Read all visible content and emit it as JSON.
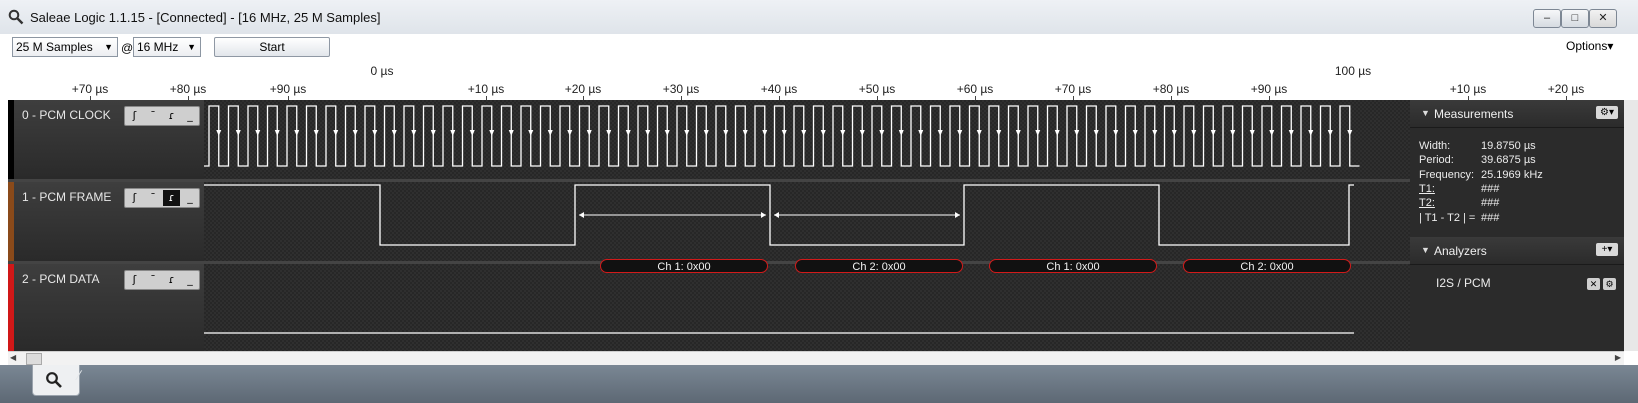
{
  "window": {
    "title": "Saleae Logic 1.1.15 - [Connected] - [16 MHz, 25 M Samples]",
    "controls": {
      "minimize": "–",
      "maximize": "□",
      "close": "✕"
    }
  },
  "toolbar": {
    "samples": "25 M Samples",
    "at": "@",
    "rate": "16 MHz",
    "start": "Start",
    "options": "Options▾"
  },
  "ruler": {
    "major_labels": [
      "0 µs",
      "100 µs"
    ],
    "minor_labels": [
      "+70 µs",
      "+80 µs",
      "+90 µs",
      "+10 µs",
      "+20 µs",
      "+30 µs",
      "+40 µs",
      "+50 µs",
      "+60 µs",
      "+70 µs",
      "+80 µs",
      "+90 µs",
      "+10 µs",
      "+20 µs"
    ]
  },
  "channels": [
    {
      "name": "0 - PCM CLOCK",
      "color": "#000000",
      "active_trigger": -1
    },
    {
      "name": "1 - PCM FRAME",
      "color": "#8a4a1a",
      "active_trigger": 2
    },
    {
      "name": "2 - PCM DATA",
      "color": "#d01818",
      "active_trigger": -1
    }
  ],
  "triggers": [
    "ʃ",
    "¯",
    "ɾ",
    "_"
  ],
  "decodes": [
    "Ch 1: 0x00",
    "Ch 2: 0x00",
    "Ch 1: 0x00",
    "Ch 2: 0x00"
  ],
  "measurements": {
    "title": "Measurements",
    "rows": [
      {
        "k": "Width:",
        "v": "19.8750 µs"
      },
      {
        "k": "Period:",
        "v": "39.6875 µs"
      },
      {
        "k": "Frequency:",
        "v": "25.1969 kHz"
      },
      {
        "k": "T1:",
        "v": "###"
      },
      {
        "k": "T2:",
        "v": "###"
      },
      {
        "k": "| T1 - T2 | =",
        "v": "###"
      }
    ]
  },
  "analyzers": {
    "title": "Analyzers",
    "items": [
      "I2S / PCM"
    ]
  },
  "icons": {
    "app": "magnifier-icon",
    "gear": "gear-icon",
    "add": "plus-icon",
    "remove": "close-icon"
  }
}
